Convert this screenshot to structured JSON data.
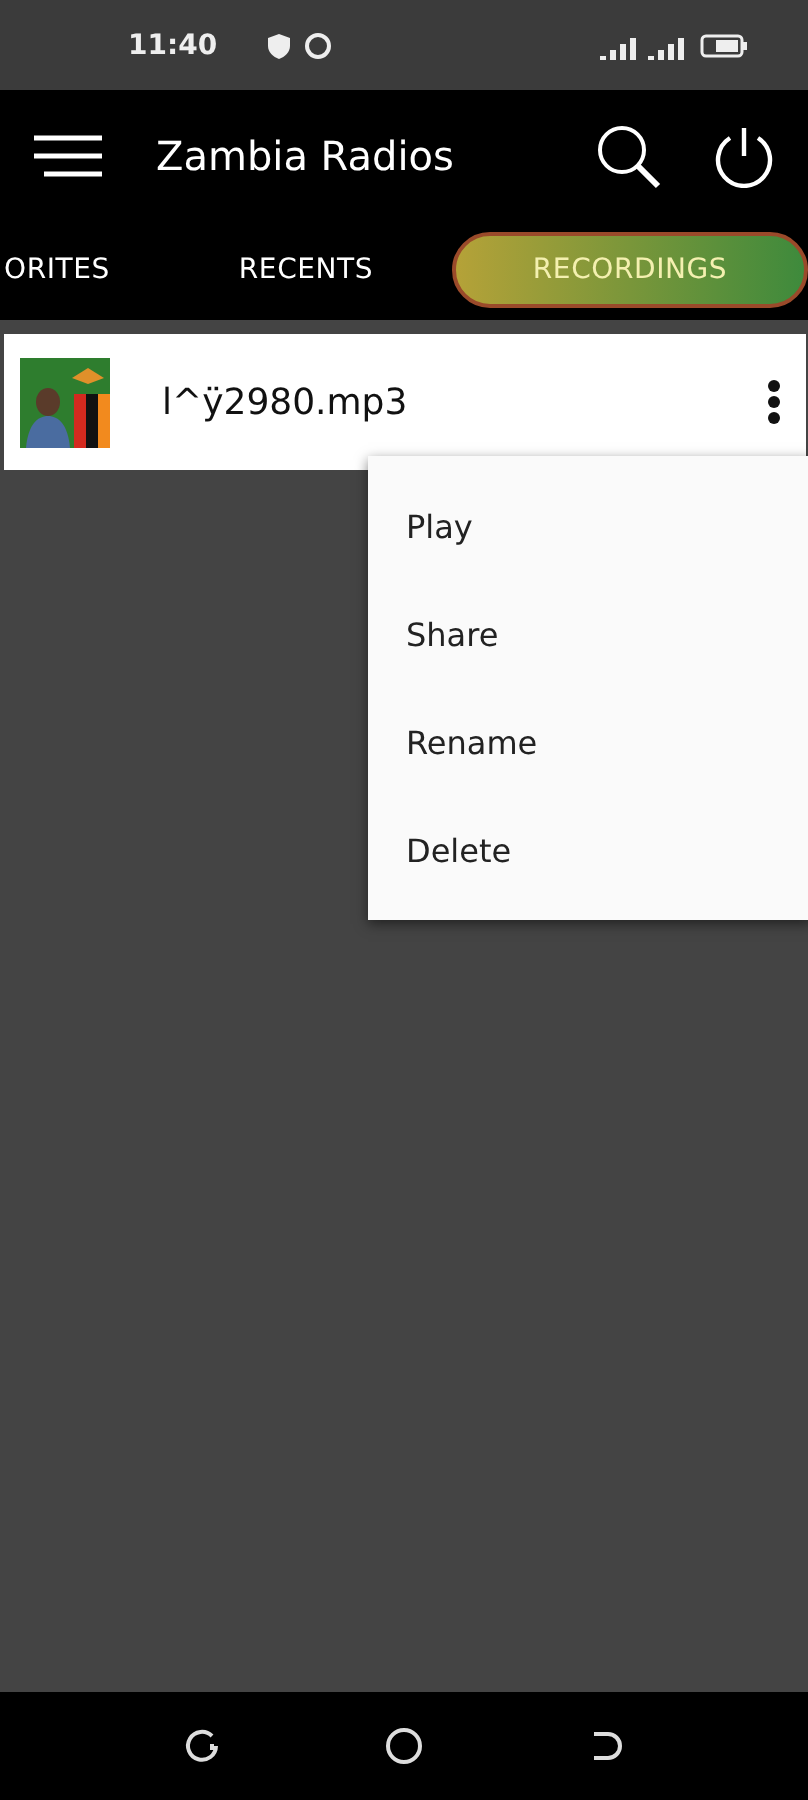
{
  "status_bar": {
    "time": "11:40"
  },
  "app_bar": {
    "title": "Zambia Radios"
  },
  "tabs": [
    {
      "label": "ORITES",
      "selected": false
    },
    {
      "label": "RECENTS",
      "selected": false
    },
    {
      "label": "RECORDINGS",
      "selected": true
    }
  ],
  "recordings": [
    {
      "name": "l^ÿ2980.mp3"
    }
  ],
  "context_menu": {
    "items": [
      "Play",
      "Share",
      "Rename",
      "Delete"
    ]
  }
}
